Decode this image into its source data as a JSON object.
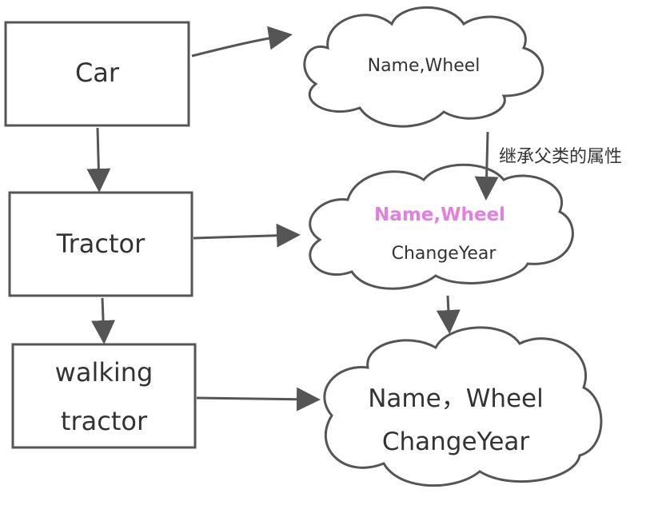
{
  "boxes": {
    "car": "Car",
    "tractor": "Tractor",
    "walking_line1": "walking",
    "walking_line2": "tractor"
  },
  "clouds": {
    "car": "Name,Wheel",
    "tractor_inherited": "Name,Wheel",
    "tractor_own": "ChangeYear",
    "walking_line1": "Name，Wheel",
    "walking_line2": "ChangeYear"
  },
  "annotation": "继承父类的属性",
  "colors": {
    "stroke": "#555555",
    "highlight": "#e27fe0"
  }
}
